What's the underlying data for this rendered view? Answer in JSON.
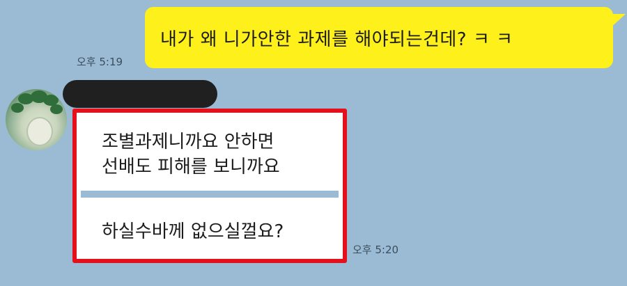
{
  "messages": {
    "outgoing": {
      "text": "내가 왜 니가안한 과제를 해야되는건데? ㅋ ㅋ",
      "time": "오후 5:19"
    },
    "incoming": {
      "line1": "조별과제니까요 안하면",
      "line2": "선배도 피해를 보니까요",
      "line3": "하실수바께 없으실껄요?",
      "time": "오후 5:20"
    }
  },
  "colors": {
    "background": "#9bbbd4",
    "outgoing_bubble": "#fef01b",
    "incoming_bubble": "#ffffff",
    "highlight_border": "#e4101c",
    "redaction": "#202020"
  }
}
